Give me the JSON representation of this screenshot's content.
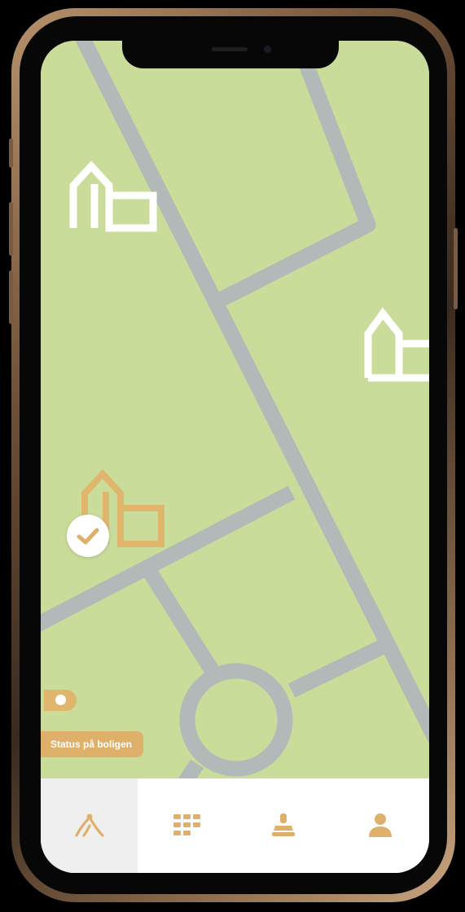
{
  "colors": {
    "map_background": "#c9dc9a",
    "road": "#b3b8b8",
    "house_default": "#ffffff",
    "house_selected": "#e0b56c",
    "accent": "#dfb06a",
    "tab_bar": "#ffffff",
    "tab_active": "#efefef",
    "tab_icon": "#dfb06a"
  },
  "map": {
    "markers": [
      {
        "icon": "house-icon",
        "state": "default"
      },
      {
        "icon": "house-icon",
        "state": "default"
      },
      {
        "icon": "house-icon",
        "state": "selected"
      }
    ],
    "selected_badge_icon": "checkmark-icon",
    "poi_icon": "location-dot-icon",
    "tooltip_label": "Status på boligen"
  },
  "tab_bar": {
    "tabs": [
      {
        "icon": "route-icon",
        "active": true
      },
      {
        "icon": "calendar-grid-icon",
        "active": false
      },
      {
        "icon": "stamp-icon",
        "active": false
      },
      {
        "icon": "profile-icon",
        "active": false
      }
    ]
  }
}
